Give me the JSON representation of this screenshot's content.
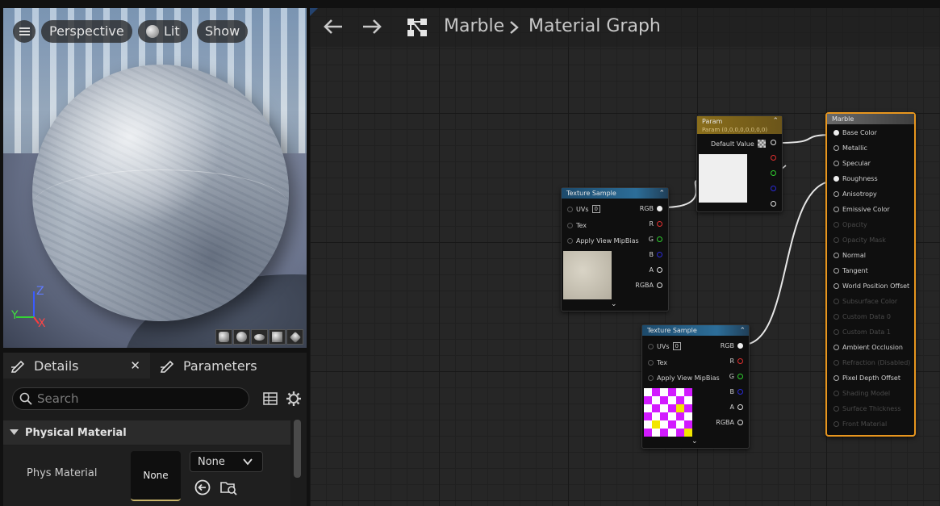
{
  "viewport": {
    "perspective_label": "Perspective",
    "lit_label": "Lit",
    "show_label": "Show",
    "axis_z": "Z",
    "axis_y": "Y",
    "axis_x": "X"
  },
  "panel": {
    "tabs": [
      {
        "label": "Details"
      },
      {
        "label": "Parameters"
      }
    ],
    "search_placeholder": "Search",
    "section_title": "Physical Material",
    "prop_label": "Phys Material",
    "thumb_value": "None",
    "combo_value": "None"
  },
  "graph": {
    "breadcrumb_root": "Marble",
    "breadcrumb_current": "Material Graph",
    "param_node": {
      "title": "Param",
      "subtitle": "Param (0,0,0,0,0,0,0,0)",
      "default_label": "Default Value"
    },
    "tex_node_1": {
      "title": "Texture Sample",
      "uvs": "UVs",
      "uv_index": "0",
      "tex": "Tex",
      "apply": "Apply View MipBias",
      "outputs": [
        "RGB",
        "R",
        "G",
        "B",
        "A",
        "RGBA"
      ]
    },
    "tex_node_2": {
      "title": "Texture Sample",
      "uvs": "UVs",
      "uv_index": "0",
      "tex": "Tex",
      "apply": "Apply View MipBias",
      "outputs": [
        "RGB",
        "R",
        "G",
        "B",
        "A",
        "RGBA"
      ]
    },
    "material_node": {
      "title": "Marble",
      "inputs": [
        {
          "label": "Base Color",
          "enabled": true,
          "connected": true
        },
        {
          "label": "Metallic",
          "enabled": true,
          "connected": false
        },
        {
          "label": "Specular",
          "enabled": true,
          "connected": false
        },
        {
          "label": "Roughness",
          "enabled": true,
          "connected": true
        },
        {
          "label": "Anisotropy",
          "enabled": true,
          "connected": false
        },
        {
          "label": "Emissive Color",
          "enabled": true,
          "connected": false
        },
        {
          "label": "Opacity",
          "enabled": false,
          "connected": false
        },
        {
          "label": "Opacity Mask",
          "enabled": false,
          "connected": false
        },
        {
          "label": "Normal",
          "enabled": true,
          "connected": false
        },
        {
          "label": "Tangent",
          "enabled": true,
          "connected": false
        },
        {
          "label": "World Position Offset",
          "enabled": true,
          "connected": false
        },
        {
          "label": "Subsurface Color",
          "enabled": false,
          "connected": false
        },
        {
          "label": "Custom Data 0",
          "enabled": false,
          "connected": false
        },
        {
          "label": "Custom Data 1",
          "enabled": false,
          "connected": false
        },
        {
          "label": "Ambient Occlusion",
          "enabled": true,
          "connected": false
        },
        {
          "label": "Refraction (Disabled)",
          "enabled": false,
          "connected": false
        },
        {
          "label": "Pixel Depth Offset",
          "enabled": true,
          "connected": false
        },
        {
          "label": "Shading Model",
          "enabled": false,
          "connected": false
        },
        {
          "label": "Surface Thickness",
          "enabled": false,
          "connected": false
        },
        {
          "label": "Front Material",
          "enabled": false,
          "connected": false
        }
      ]
    }
  },
  "colors": {
    "accent_selection": "#e8961e",
    "param_header": "#8a6e1b",
    "texture_header": "#2c6d98"
  }
}
